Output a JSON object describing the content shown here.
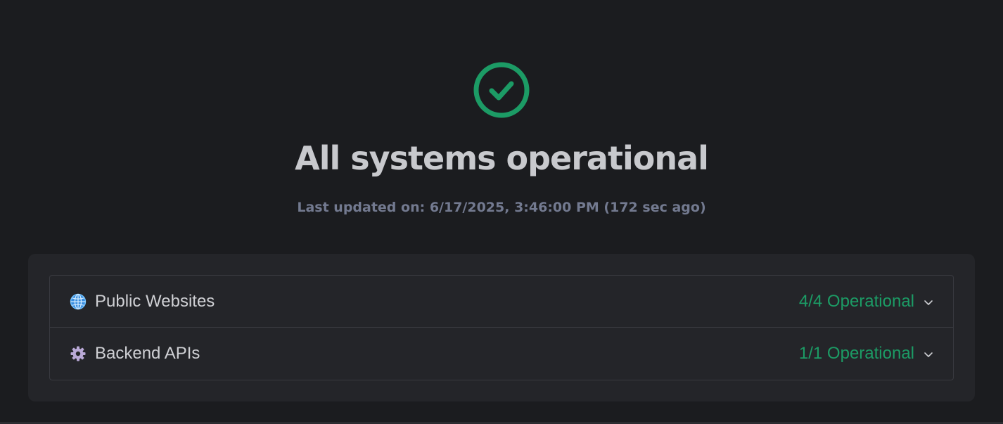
{
  "hero": {
    "status_icon": "check-circle-icon",
    "title": "All systems operational",
    "last_updated": "Last updated on: 6/17/2025, 3:46:00 PM (172 sec ago)"
  },
  "groups": [
    {
      "icon": "globe-icon",
      "label": "Public Websites",
      "status": "4/4 Operational",
      "expand_icon": "chevron-down-icon"
    },
    {
      "icon": "gear-icon",
      "label": "Backend APIs",
      "status": "1/1 Operational",
      "expand_icon": "chevron-down-icon"
    }
  ],
  "colors": {
    "background": "#1b1c1f",
    "panel": "#242529",
    "operational_green": "#1c9b65",
    "title_text": "#c8c9cd",
    "muted_text": "#737a90"
  }
}
